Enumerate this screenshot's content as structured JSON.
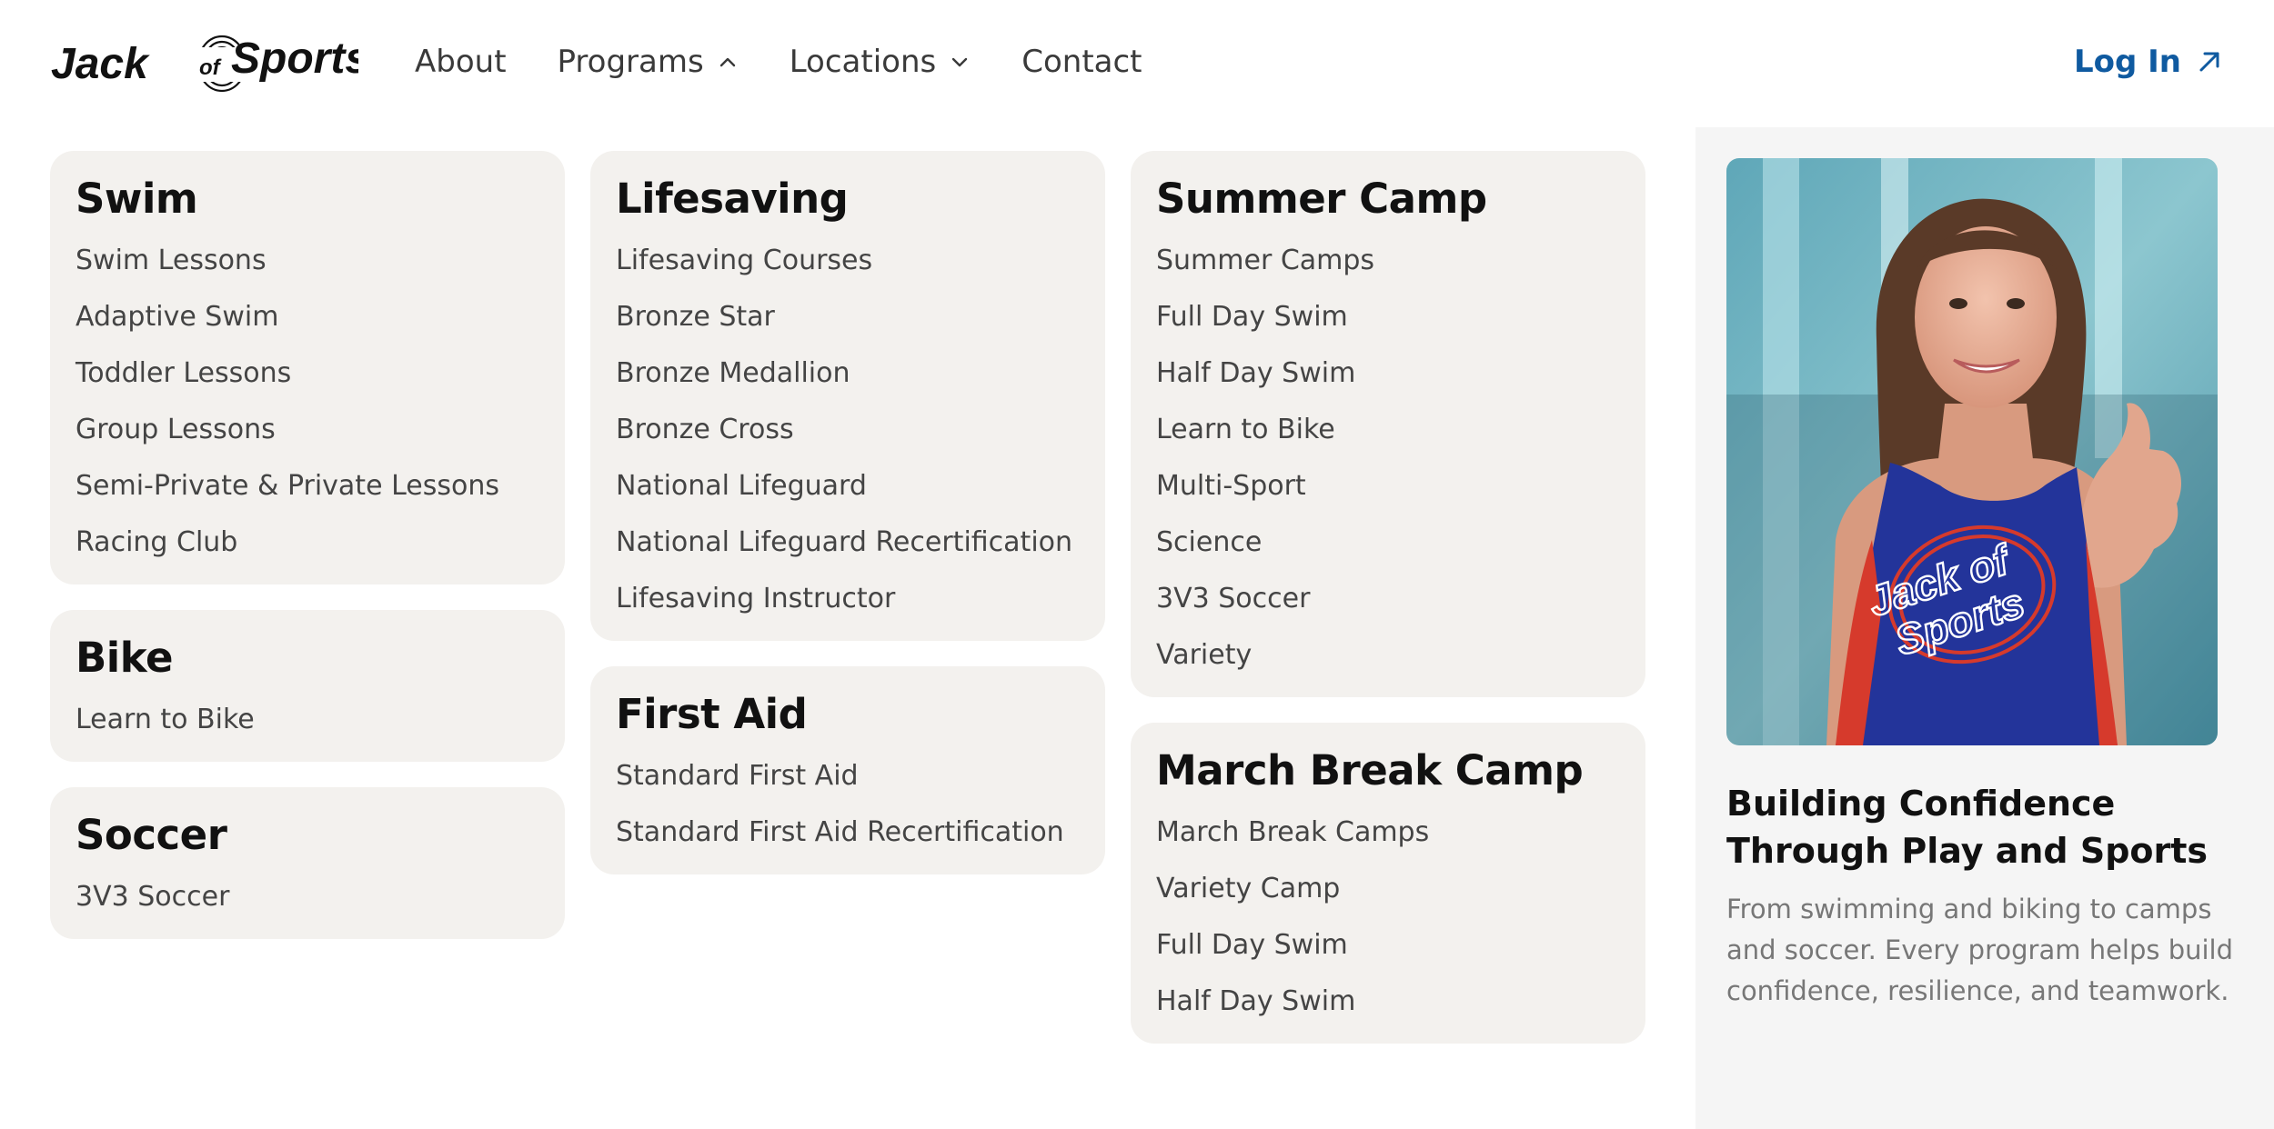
{
  "brand": {
    "name": "Jack of Sports"
  },
  "nav": {
    "items": [
      {
        "label": "About",
        "icon": null
      },
      {
        "label": "Programs",
        "icon": "chevron-up-icon"
      },
      {
        "label": "Locations",
        "icon": "chevron-down-icon"
      },
      {
        "label": "Contact",
        "icon": null
      }
    ],
    "login_label": "Log In",
    "login_icon": "arrow-up-right-icon",
    "accent_color": "#0f5aa0"
  },
  "menu": {
    "swim": {
      "title": "Swim",
      "items": [
        "Swim Lessons",
        "Adaptive Swim",
        "Toddler Lessons",
        "Group Lessons",
        "Semi-Private & Private Lessons",
        "Racing Club"
      ]
    },
    "bike": {
      "title": "Bike",
      "items": [
        "Learn to Bike"
      ]
    },
    "soccer": {
      "title": "Soccer",
      "items": [
        "3V3 Soccer"
      ]
    },
    "lifesaving": {
      "title": "Lifesaving",
      "items": [
        "Lifesaving Courses",
        "Bronze Star",
        "Bronze Medallion",
        "Bronze Cross",
        "National Lifeguard",
        "National Lifeguard Recertification",
        "Lifesaving Instructor"
      ]
    },
    "first_aid": {
      "title": "First Aid",
      "items": [
        "Standard First Aid",
        "Standard First Aid Recertification"
      ]
    },
    "summer_camp": {
      "title": "Summer Camp",
      "items": [
        "Summer Camps",
        "Full Day Swim",
        "Half Day Swim",
        "Learn to Bike",
        "Multi-Sport",
        "Science",
        "3V3 Soccer",
        "Variety"
      ]
    },
    "march_break": {
      "title": "March Break Camp",
      "items": [
        "March Break Camps",
        "Variety Camp",
        "Full Day Swim",
        "Half Day Swim"
      ]
    }
  },
  "feature": {
    "title": "Building Confidence Through Play and Sports",
    "description": "From swimming and biking to camps and soccer. Every program helps build confidence, resilience, and teamwork.",
    "photo_shirt_text_1": "Jack of",
    "photo_shirt_text_2": "Sports"
  }
}
